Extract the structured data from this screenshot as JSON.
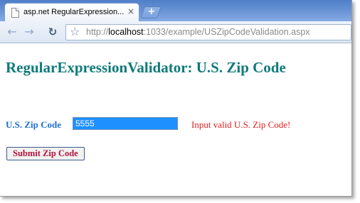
{
  "browser": {
    "tab_title": "asp.net RegularExpression...",
    "tab_close": "×",
    "new_tab": "+",
    "url_scheme": "http://",
    "url_host": "localhost",
    "url_rest": ":1033/example/USZipCodeValidation.aspx",
    "icons": {
      "back": "back-arrow-icon",
      "forward": "forward-arrow-icon",
      "reload": "reload-icon",
      "bookmark": "star-icon",
      "page": "page-icon"
    }
  },
  "page": {
    "title": "RegularExpressionValidator: U.S. Zip Code",
    "zip_label": "U.S. Zip Code",
    "zip_value": "5555",
    "error_message": "Input valid U.S. Zip Code!",
    "submit_label": "Submit Zip Code"
  },
  "colors": {
    "title": "#0f7a7a",
    "label": "#1e6fd0",
    "error": "#e11d1d",
    "input_bg": "#1e90ff",
    "button_text": "#b3123c"
  }
}
